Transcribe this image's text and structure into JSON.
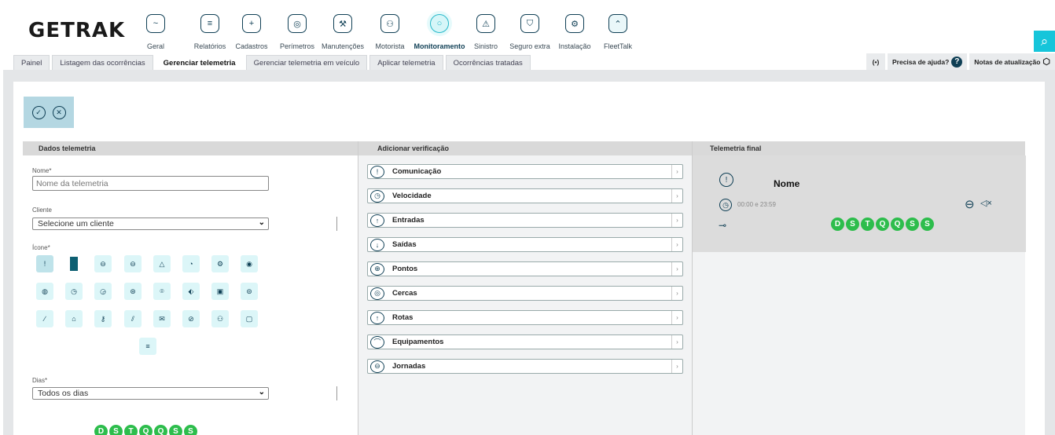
{
  "brand": {
    "logo": "GETRAK"
  },
  "modules": [
    {
      "label": "Geral",
      "icon": "pulse-icon",
      "glyph": "~"
    },
    {
      "label": "Relatórios",
      "icon": "report-icon",
      "glyph": "≡"
    },
    {
      "label": "Cadastros",
      "icon": "folder-plus-icon",
      "glyph": "+"
    },
    {
      "label": "Perímetros",
      "icon": "target-icon",
      "glyph": "◎"
    },
    {
      "label": "Manutenções",
      "icon": "wrench-icon",
      "glyph": "⚒"
    },
    {
      "label": "Motorista",
      "icon": "driver-icon",
      "glyph": "⚇"
    },
    {
      "label": "Monitoramento",
      "icon": "monitor-icon",
      "glyph": "○"
    },
    {
      "label": "Sinistro",
      "icon": "siren-icon",
      "glyph": "⚠"
    },
    {
      "label": "Seguro extra",
      "icon": "shield-icon",
      "glyph": "⛉"
    },
    {
      "label": "Instalação",
      "icon": "install-icon",
      "glyph": "⚙"
    },
    {
      "label": "FleetTalk",
      "icon": "fleettalk-icon",
      "glyph": "⌃"
    }
  ],
  "tabs": [
    {
      "label": "Painel"
    },
    {
      "label": "Listagem das ocorrências"
    },
    {
      "label": "Gerenciar telemetria"
    },
    {
      "label": "Gerenciar telemetria em veículo"
    },
    {
      "label": "Aplicar telemetria"
    },
    {
      "label": "Ocorrências tratadas"
    }
  ],
  "tools": {
    "help": "Precisa de ajuda?",
    "updates": "Notas de atualização"
  },
  "panels": {
    "dados": "Dados telemetria",
    "adicionar": "Adicionar verificação",
    "final": "Telemetria final"
  },
  "form": {
    "nome_label": "Nome*",
    "nome_placeholder": "Nome da telemetria",
    "cliente_label": "Cliente",
    "cliente_value": "Selecione um cliente",
    "icone_label": "Ícone*",
    "dias_label": "Dias*",
    "dias_value": "Todos os dias"
  },
  "days": [
    "D",
    "S",
    "T",
    "Q",
    "Q",
    "S",
    "S"
  ],
  "verifications": [
    {
      "label": "Comunicação",
      "glyph": "!"
    },
    {
      "label": "Velocidade",
      "glyph": "◷"
    },
    {
      "label": "Entradas",
      "glyph": "↑"
    },
    {
      "label": "Saídas",
      "glyph": "↓"
    },
    {
      "label": "Pontos",
      "glyph": "⊕"
    },
    {
      "label": "Cercas",
      "glyph": "◎"
    },
    {
      "label": "Rotas",
      "glyph": "↑"
    },
    {
      "label": "Equipamentos",
      "glyph": "⌒"
    },
    {
      "label": "Jornadas",
      "glyph": "⊖"
    }
  ],
  "final": {
    "nome": "Nome",
    "time": "00:00 e 23:59"
  },
  "colors": {
    "accent": "#16c5da",
    "dark": "#0f3f55",
    "day_green": "#2dbd4c"
  }
}
